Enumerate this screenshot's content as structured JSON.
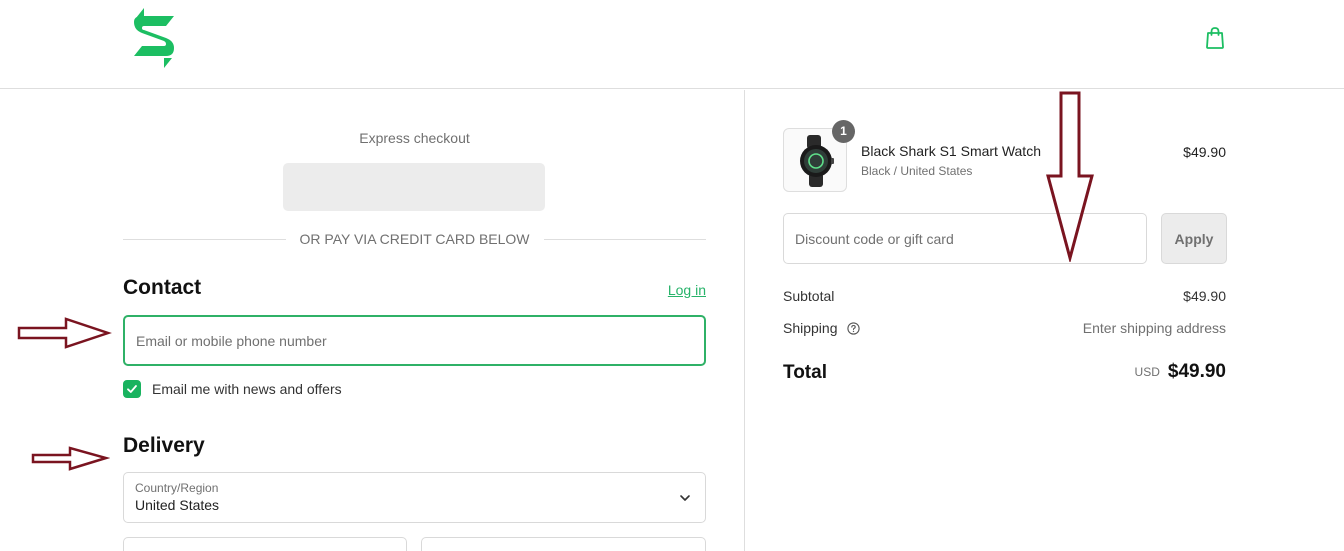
{
  "brand": {
    "color": "#1cbe62",
    "logo_icon": "black-shark-logo"
  },
  "header": {
    "cart_icon": "shopping-bag-icon"
  },
  "express": {
    "label": "Express checkout",
    "divider_text": "OR PAY VIA CREDIT CARD BELOW"
  },
  "contact": {
    "title": "Contact",
    "login_link": "Log in",
    "email_placeholder": "Email or mobile phone number",
    "email_value": "",
    "newsletter_label": "Email me with news and offers",
    "newsletter_checked": true
  },
  "delivery": {
    "title": "Delivery",
    "country_label": "Country/Region",
    "country_value": "United States"
  },
  "order": {
    "item": {
      "name": "Black Shark S1 Smart Watch",
      "variant": "Black / United States",
      "price": "$49.90",
      "quantity": "1"
    },
    "discount_placeholder": "Discount code or gift card",
    "apply_label": "Apply",
    "subtotal_label": "Subtotal",
    "subtotal_value": "$49.90",
    "shipping_label": "Shipping",
    "shipping_value": "Enter shipping address",
    "total_label": "Total",
    "total_currency": "USD",
    "total_value": "$49.90"
  },
  "annotation_color": "#7a1420"
}
